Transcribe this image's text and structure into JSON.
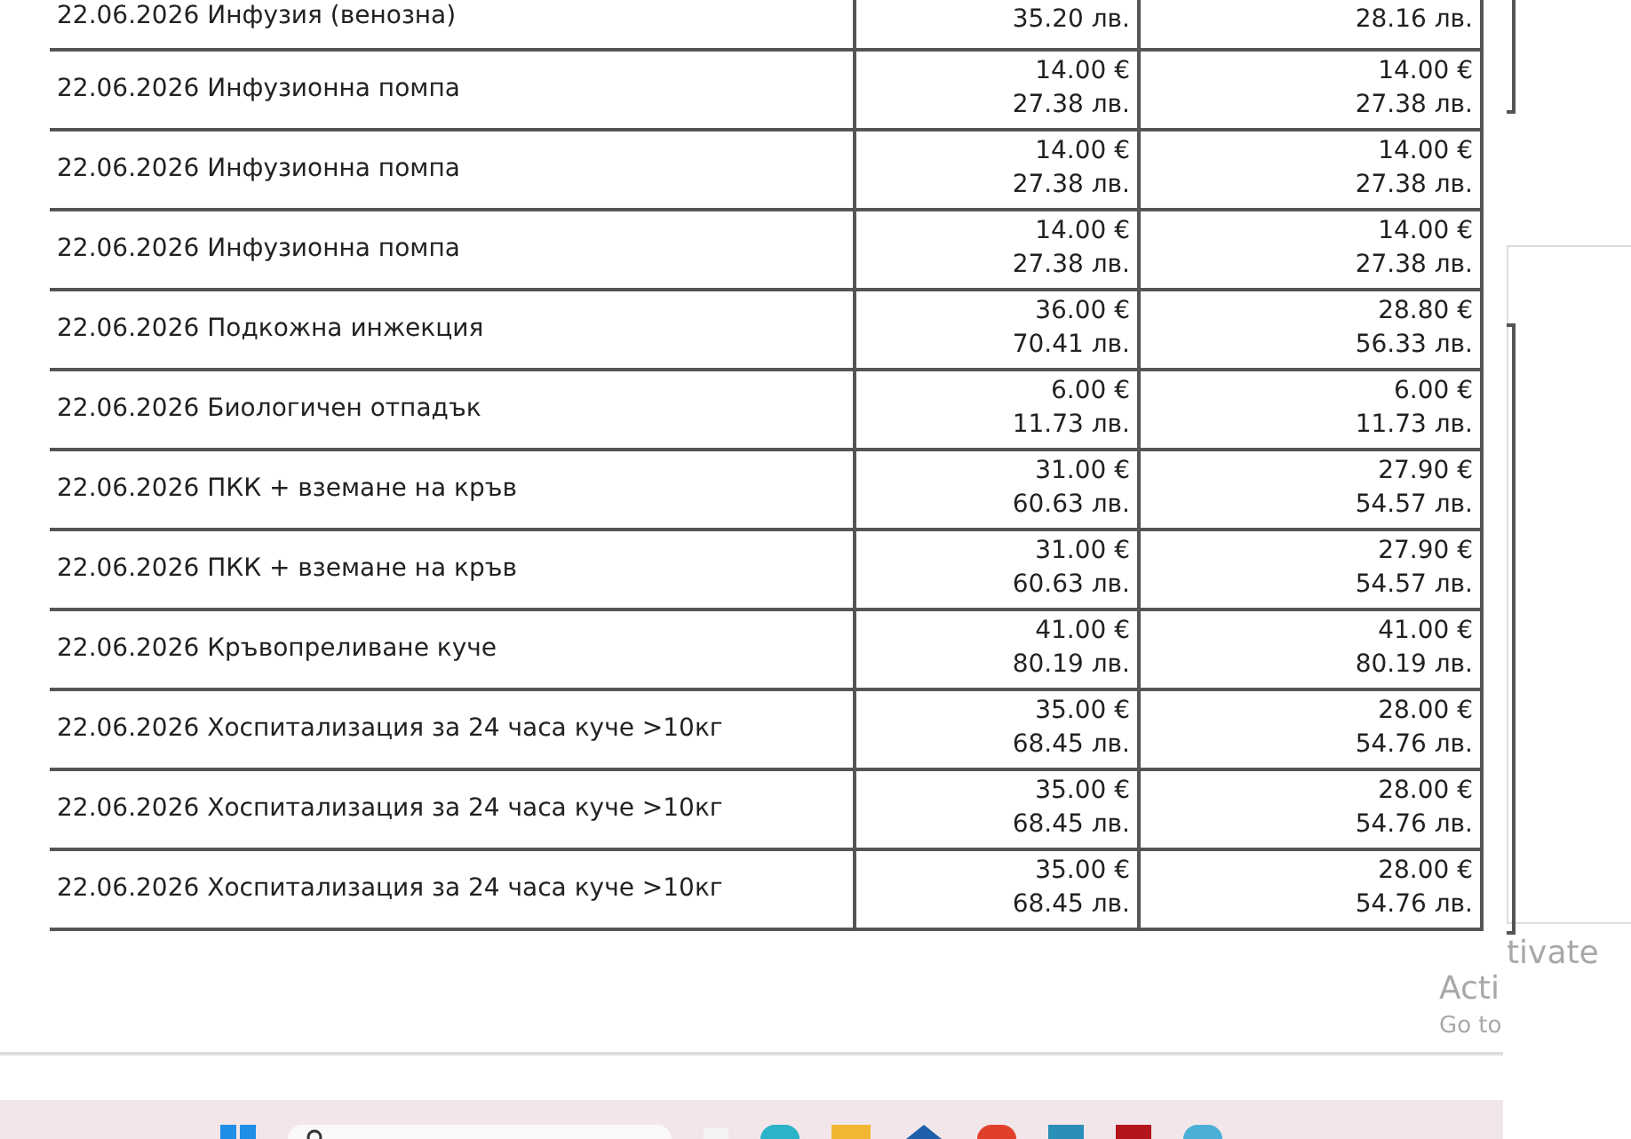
{
  "table": {
    "rows": [
      {
        "description": "22.06.2026 Инфузия (венозна)",
        "column_2": [
          "35.20 лв."
        ],
        "column_3": [
          "28.16 лв."
        ]
      },
      {
        "description": "22.06.2026 Инфузионна помпа",
        "column_2": [
          "14.00 €",
          "27.38 лв."
        ],
        "column_3": [
          "14.00 €",
          "27.38 лв."
        ]
      },
      {
        "description": "22.06.2026 Инфузионна помпа",
        "column_2": [
          "14.00 €",
          "27.38 лв."
        ],
        "column_3": [
          "14.00 €",
          "27.38 лв."
        ]
      },
      {
        "description": "22.06.2026 Инфузионна помпа",
        "column_2": [
          "14.00 €",
          "27.38 лв."
        ],
        "column_3": [
          "14.00 €",
          "27.38 лв."
        ]
      },
      {
        "description": "22.06.2026 Подкожна инжекция",
        "column_2": [
          "36.00 €",
          "70.41 лв."
        ],
        "column_3": [
          "28.80 €",
          "56.33 лв."
        ]
      },
      {
        "description": "22.06.2026 Биологичен отпадък",
        "column_2": [
          "6.00 €",
          "11.73 лв."
        ],
        "column_3": [
          "6.00 €",
          "11.73 лв."
        ]
      },
      {
        "description": "22.06.2026 ПКК + вземане на кръв",
        "column_2": [
          "31.00 €",
          "60.63 лв."
        ],
        "column_3": [
          "27.90 €",
          "54.57 лв."
        ]
      },
      {
        "description": "22.06.2026 ПКК + вземане на кръв",
        "column_2": [
          "31.00 €",
          "60.63 лв."
        ],
        "column_3": [
          "27.90 €",
          "54.57 лв."
        ]
      },
      {
        "description": "22.06.2026 Кръвопреливане куче",
        "column_2": [
          "41.00 €",
          "80.19 лв."
        ],
        "column_3": [
          "41.00 €",
          "80.19 лв."
        ]
      },
      {
        "description": "22.06.2026 Хоспитализация за 24 часа куче >10кг",
        "column_2": [
          "35.00 €",
          "68.45 лв."
        ],
        "column_3": [
          "28.00 €",
          "54.76 лв."
        ]
      },
      {
        "description": "22.06.2026 Хоспитализация за 24 часа куче >10кг",
        "column_2": [
          "35.00 €",
          "68.45 лв."
        ],
        "column_3": [
          "28.00 €",
          "54.76 лв."
        ]
      },
      {
        "description": "22.06.2026 Хоспитализация за 24 часа куче >10кг",
        "column_2": [
          "35.00 €",
          "68.45 лв."
        ],
        "column_3": [
          "28.00 €",
          "54.76 лв."
        ]
      }
    ]
  },
  "activation_notice": {
    "fragment_1": "tivate",
    "fragment_2": "Acti",
    "fragment_3": "Go to"
  }
}
